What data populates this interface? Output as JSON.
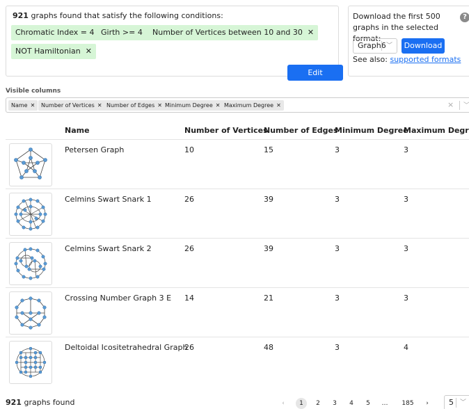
{
  "conditions": {
    "count": "921",
    "text": " graphs found that satisfy the following conditions:",
    "chips": [
      "Chromatic Index = 4",
      "Girth >= 4",
      "Number of Vertices between 10 and 30",
      "NOT Hamiltonian"
    ],
    "edit_label": "Edit conditions"
  },
  "download": {
    "text": "Download the first 500 graphs in the selected format:",
    "help": "?",
    "format": "Graph6",
    "button": "Download",
    "see_also": "See also: ",
    "link": "supported formats"
  },
  "visible_columns": {
    "label": "Visible columns",
    "chips": [
      "Name",
      "Number of Vertices",
      "Number of Edges",
      "Minimum Degree",
      "Maximum Degree"
    ],
    "clear": "×"
  },
  "table": {
    "headers": [
      "Name",
      "Number of Vertices",
      "Number of Edges",
      "Minimum Degree",
      "Maximum Degree"
    ],
    "rows": [
      {
        "name": "Petersen Graph",
        "vertices": "10",
        "edges": "15",
        "min": "3",
        "max": "3",
        "thumbnail": "graph-drawing"
      },
      {
        "name": "Celmins Swart Snark 1",
        "vertices": "26",
        "edges": "39",
        "min": "3",
        "max": "3",
        "thumbnail": "graph-drawing"
      },
      {
        "name": "Celmins Swart Snark 2",
        "vertices": "26",
        "edges": "39",
        "min": "3",
        "max": "3",
        "thumbnail": "graph-drawing"
      },
      {
        "name": "Crossing Number Graph 3 E",
        "vertices": "14",
        "edges": "21",
        "min": "3",
        "max": "3",
        "thumbnail": "graph-drawing"
      },
      {
        "name": "Deltoidal Icositetrahedral Graph",
        "vertices": "26",
        "edges": "48",
        "min": "3",
        "max": "4",
        "thumbnail": "graph-drawing"
      }
    ]
  },
  "footer": {
    "count": "921",
    "text": " graphs found",
    "prev": "‹",
    "pages": [
      "1",
      "2",
      "3",
      "4",
      "5",
      "…",
      "185"
    ],
    "next": "›",
    "page_size": "5"
  },
  "colors": {
    "accent": "#1a6ff2",
    "chip_green": "#d6f5d6",
    "node": "#5b9bd5"
  }
}
